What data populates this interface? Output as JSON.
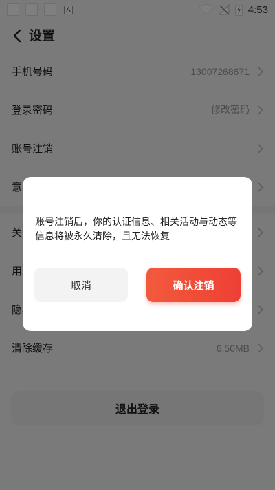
{
  "status_bar": {
    "time": "4:53",
    "a_icon_label": "A"
  },
  "header": {
    "title": "设置"
  },
  "settings": {
    "items": [
      {
        "label": "手机号码",
        "value": "13007268671"
      },
      {
        "label": "登录密码",
        "value": "修改密码"
      },
      {
        "label": "账号注销",
        "value": ""
      },
      {
        "label": "意见反馈",
        "value": ""
      },
      {
        "label": "关于我们",
        "value": ""
      },
      {
        "label": "用户协议",
        "value": ""
      },
      {
        "label": "隐私政策",
        "value": ""
      },
      {
        "label": "清除缓存",
        "value": "6.50MB"
      }
    ]
  },
  "logout": {
    "label": "退出登录"
  },
  "dialog": {
    "message": "账号注销后，你的认证信息、相关活动与动态等信息将被永久清除，且无法恢复",
    "cancel_label": "取消",
    "confirm_label": "确认注销",
    "confirm_color": "#F04A38"
  }
}
